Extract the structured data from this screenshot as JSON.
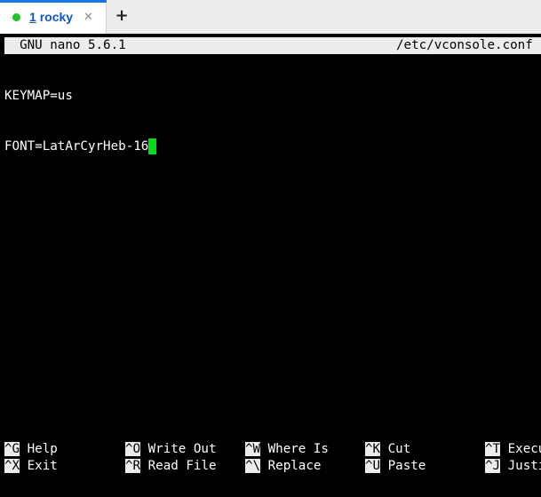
{
  "tabbar": {
    "active_tab": {
      "number": "1",
      "name": "rocky",
      "status_color": "#22c02a",
      "close_icon": "close-icon"
    },
    "new_tab_glyph": "+"
  },
  "nano": {
    "title_left": "  GNU nano 5.6.1",
    "title_right": "/etc/vconsole.conf",
    "lines": [
      "KEYMAP=us",
      "FONT=LatArCyrHeb-16"
    ],
    "cursor_color": "#00e01a",
    "shortcuts": [
      [
        {
          "key": "^G",
          "label": "Help"
        },
        {
          "key": "^O",
          "label": "Write Out"
        },
        {
          "key": "^W",
          "label": "Where Is"
        },
        {
          "key": "^K",
          "label": "Cut"
        },
        {
          "key": "^T",
          "label": "Execute"
        }
      ],
      [
        {
          "key": "^X",
          "label": "Exit"
        },
        {
          "key": "^R",
          "label": "Read File"
        },
        {
          "key": "^\\",
          "label": "Replace"
        },
        {
          "key": "^U",
          "label": "Paste"
        },
        {
          "key": "^J",
          "label": "Justify"
        }
      ]
    ]
  }
}
